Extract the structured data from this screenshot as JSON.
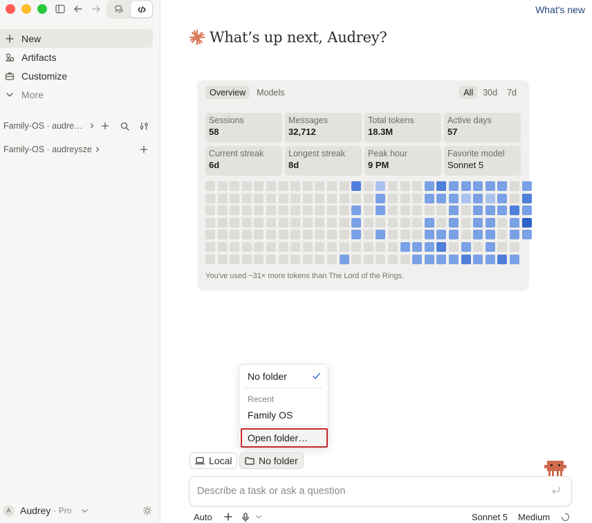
{
  "window": {
    "mode_toggle": [
      "chat-icon",
      "code-icon"
    ],
    "active_mode": "code"
  },
  "sidebar": {
    "nav": [
      {
        "label": "New",
        "icon": "plus-icon",
        "active": true
      },
      {
        "label": "Artifacts",
        "icon": "artifacts-icon",
        "active": false
      },
      {
        "label": "Customize",
        "icon": "briefcase-icon",
        "active": false
      },
      {
        "label": "More",
        "icon": "chevron-down-icon",
        "active": false
      }
    ],
    "projects": [
      {
        "label": "Family-OS · audre…"
      },
      {
        "label": "Family-OS · audreysze"
      }
    ],
    "user": {
      "initial": "A",
      "name": "Audrey",
      "plan": "· Pro"
    }
  },
  "header": {
    "whats_new": "What's new"
  },
  "greeting": {
    "text": "What’s up next, Audrey?",
    "accent": "#d97757"
  },
  "stats": {
    "tabs": [
      "Overview",
      "Models"
    ],
    "active_tab": "Overview",
    "ranges": [
      "All",
      "30d",
      "7d"
    ],
    "active_range": "All",
    "tiles": [
      {
        "label": "Sessions",
        "value": "58"
      },
      {
        "label": "Messages",
        "value": "32,712"
      },
      {
        "label": "Total tokens",
        "value": "18.3M"
      },
      {
        "label": "Active days",
        "value": "57"
      },
      {
        "label": "Current streak",
        "value": "6d"
      },
      {
        "label": "Longest streak",
        "value": "8d"
      },
      {
        "label": "Peak hour",
        "value": "9 PM"
      },
      {
        "label": "Favorite model",
        "value": "Sonnet 5"
      }
    ],
    "heatmap": {
      "levels": [
        [
          0,
          0,
          0,
          0,
          0,
          0,
          0,
          0,
          0,
          0,
          0,
          0,
          3,
          0,
          1,
          0,
          0,
          0,
          2,
          3,
          2,
          2,
          2,
          2,
          2,
          0,
          2
        ],
        [
          0,
          0,
          0,
          0,
          0,
          0,
          0,
          0,
          0,
          0,
          0,
          0,
          0,
          0,
          2,
          0,
          0,
          0,
          2,
          2,
          2,
          1,
          2,
          1,
          2,
          0,
          3
        ],
        [
          0,
          0,
          0,
          0,
          0,
          0,
          0,
          0,
          0,
          0,
          0,
          0,
          2,
          0,
          2,
          0,
          0,
          0,
          0,
          0,
          2,
          0,
          2,
          2,
          2,
          3,
          2
        ],
        [
          0,
          0,
          0,
          0,
          0,
          0,
          0,
          0,
          0,
          0,
          0,
          0,
          2,
          0,
          0,
          0,
          0,
          0,
          2,
          0,
          2,
          0,
          2,
          2,
          0,
          2,
          4
        ],
        [
          0,
          0,
          0,
          0,
          0,
          0,
          0,
          0,
          0,
          0,
          0,
          0,
          2,
          0,
          2,
          0,
          0,
          0,
          2,
          2,
          2,
          0,
          2,
          2,
          0,
          2,
          2
        ],
        [
          0,
          0,
          0,
          0,
          0,
          0,
          0,
          0,
          0,
          0,
          0,
          0,
          0,
          0,
          0,
          0,
          2,
          2,
          2,
          3,
          0,
          2,
          0,
          2,
          0,
          0,
          -1
        ],
        [
          0,
          0,
          0,
          0,
          0,
          0,
          0,
          0,
          0,
          0,
          0,
          2,
          0,
          0,
          0,
          0,
          0,
          2,
          2,
          2,
          2,
          3,
          2,
          2,
          3,
          2,
          -1
        ]
      ],
      "colors": [
        "#dddcd8",
        "#a9c3ee",
        "#7aa1e6",
        "#4f7fd9",
        "#2f63c9"
      ]
    },
    "note": "You've used ~31× more tokens than The Lord of the Rings."
  },
  "folder_menu": {
    "selected": "No folder",
    "recent_label": "Recent",
    "recent": [
      "Family OS"
    ],
    "open_folder": "Open folder…"
  },
  "composer": {
    "env_chip": "Local",
    "folder_chip": "No folder",
    "placeholder": "Describe a task or ask a question",
    "auto": "Auto",
    "model": "Sonnet 5",
    "effort": "Medium"
  }
}
